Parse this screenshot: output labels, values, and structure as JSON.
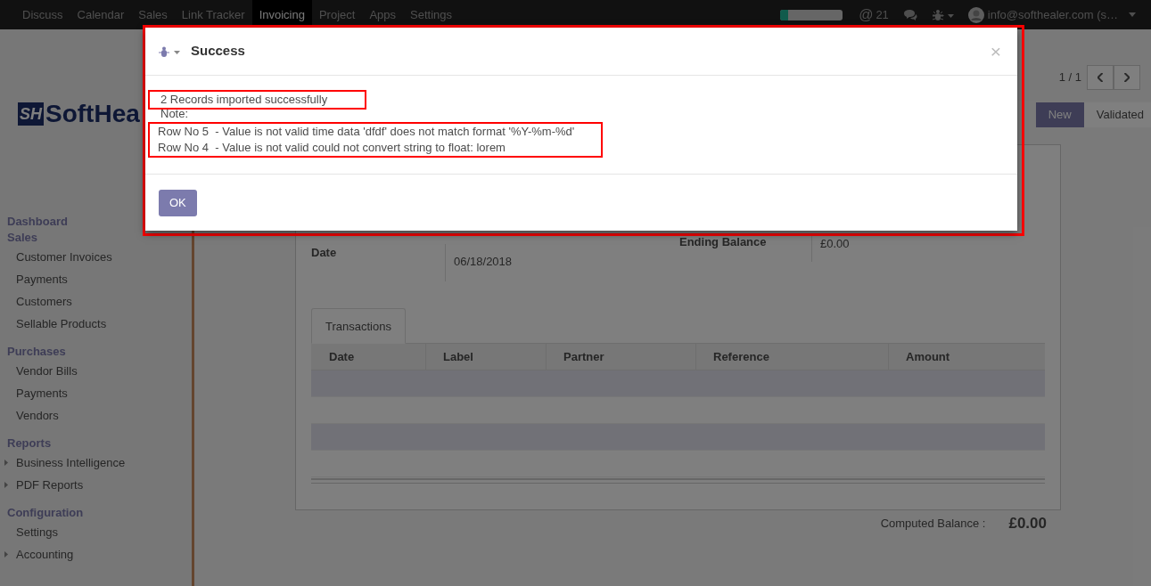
{
  "navbar": {
    "menus": [
      {
        "label": "Discuss",
        "selected": false
      },
      {
        "label": "Calendar",
        "selected": false
      },
      {
        "label": "Sales",
        "selected": false
      },
      {
        "label": "Link Tracker",
        "selected": false
      },
      {
        "label": "Invoicing",
        "selected": true
      },
      {
        "label": "Project",
        "selected": false
      },
      {
        "label": "Apps",
        "selected": false
      },
      {
        "label": "Settings",
        "selected": false
      }
    ],
    "progress": {
      "level": 0.12
    },
    "mentions": {
      "symbol": "@",
      "count": "21"
    },
    "user": "info@softhealer.com (s…"
  },
  "logo": {
    "mark": "SH",
    "text": "SoftHea"
  },
  "sidebar": {
    "sections": [
      {
        "title": "Dashboard"
      },
      {
        "title": "Sales",
        "items": [
          {
            "label": "Customer Invoices",
            "expandable": false
          },
          {
            "label": "Payments",
            "expandable": false
          },
          {
            "label": "Customers",
            "expandable": false
          },
          {
            "label": "Sellable Products",
            "expandable": false
          }
        ]
      },
      {
        "title": "Purchases",
        "items": [
          {
            "label": "Vendor Bills",
            "expandable": false
          },
          {
            "label": "Payments",
            "expandable": false
          },
          {
            "label": "Vendors",
            "expandable": false
          }
        ]
      },
      {
        "title": "Reports",
        "items": [
          {
            "label": "Business Intelligence",
            "expandable": true
          },
          {
            "label": "PDF Reports",
            "expandable": true
          }
        ]
      },
      {
        "title": "Configuration",
        "items": [
          {
            "label": "Settings",
            "expandable": false
          },
          {
            "label": "Accounting",
            "expandable": true
          }
        ]
      }
    ]
  },
  "pager": "1 / 1",
  "statusbar": [
    {
      "label": "New",
      "selected": true
    },
    {
      "label": "Validated",
      "selected": false
    }
  ],
  "form": {
    "fields": [
      {
        "label": "Date",
        "value": "06/18/2018"
      }
    ],
    "balance": {
      "label": "Ending Balance",
      "value": "£0.00"
    },
    "tabs": [
      {
        "label": "Transactions",
        "selected": true
      }
    ],
    "table": {
      "columns": [
        "Date",
        "Label",
        "Partner",
        "Reference",
        "Amount"
      ]
    },
    "computed": {
      "label": "Computed Balance :",
      "value": "£0.00"
    }
  },
  "dialog": {
    "title": "Success",
    "close": "×",
    "highlighted": true,
    "message": {
      "text": "2 Records imported successfully",
      "highlighted": true
    },
    "note": "Note:",
    "errors": {
      "highlighted": true,
      "lines": [
        "Row No 5  - Value is not valid time data 'dfdf' does not match format '%Y-%m-%d'",
        "Row No 4  - Value is not valid could not convert string to float: lorem"
      ]
    },
    "button": "OK"
  }
}
